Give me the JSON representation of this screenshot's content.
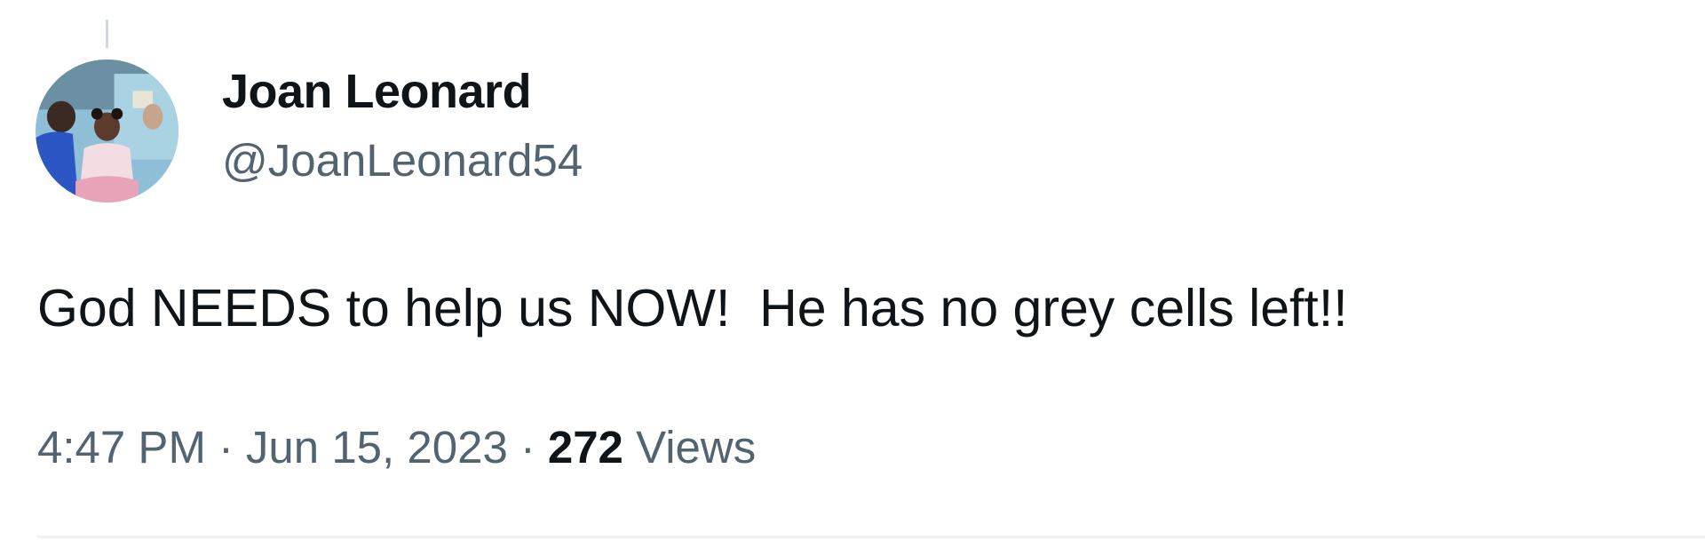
{
  "tweet": {
    "author": {
      "display_name": "Joan Leonard",
      "handle": "@JoanLeonard54",
      "avatar_icon": "profile-photo"
    },
    "text": "God NEEDS to help us NOW!  He has no grey cells left!!",
    "time": "4:47 PM",
    "separator": "·",
    "date": "Jun 15, 2023",
    "views_count": "272",
    "views_label": "Views"
  },
  "colors": {
    "primary_text": "#0f1419",
    "secondary_text": "#536471",
    "divider": "#eff3f4",
    "thread_line": "#cfd9de"
  }
}
